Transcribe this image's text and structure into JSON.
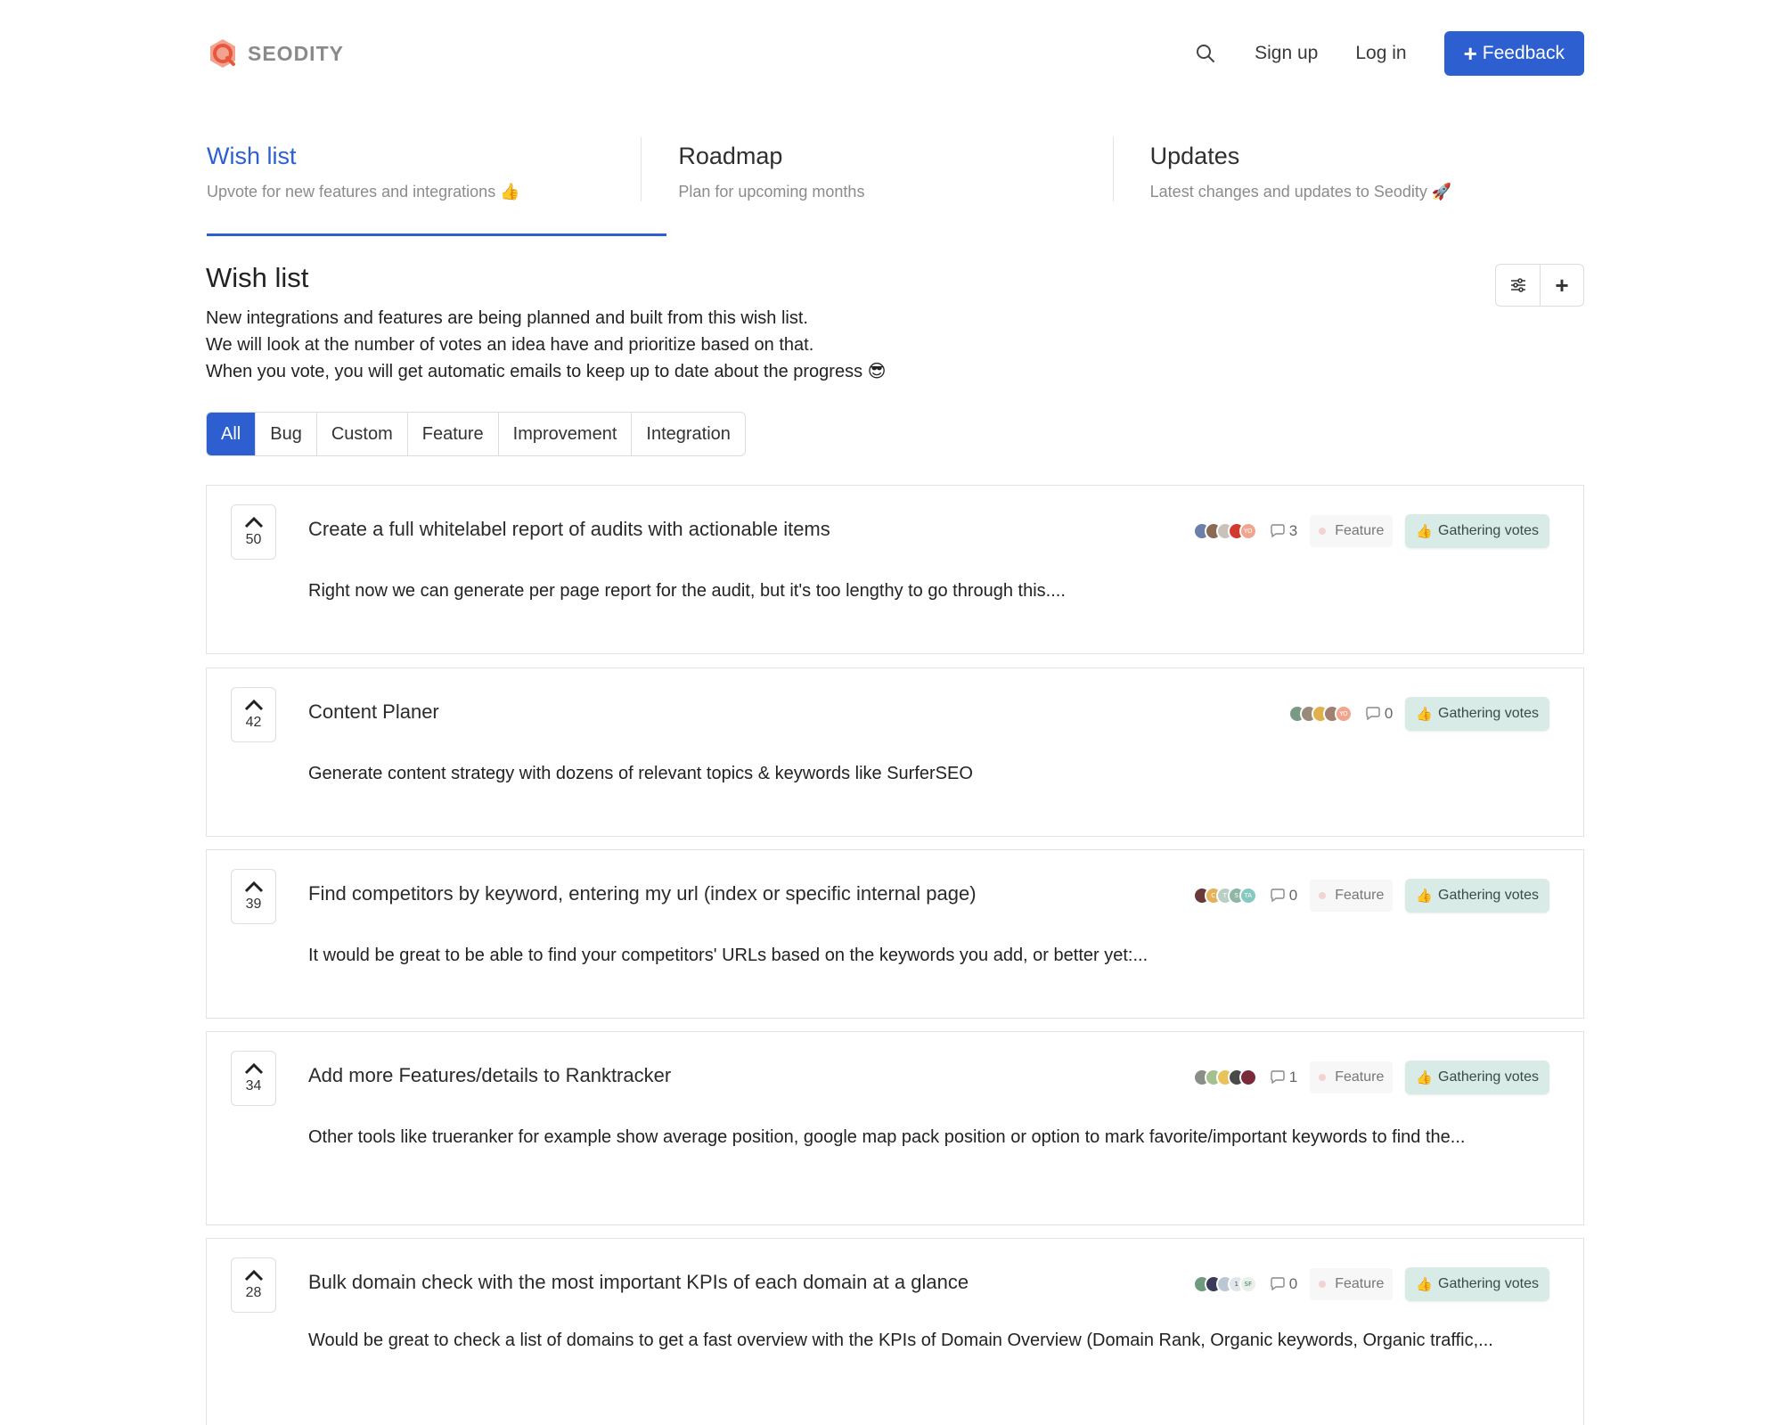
{
  "header": {
    "brand": "SEODITY",
    "signup": "Sign up",
    "login": "Log in",
    "feedback": "Feedback",
    "search_icon": "search-icon"
  },
  "tabs": [
    {
      "title": "Wish list",
      "subtitle": "Upvote for new features and integrations 👍"
    },
    {
      "title": "Roadmap",
      "subtitle": "Plan for upcoming months"
    },
    {
      "title": "Updates",
      "subtitle": "Latest changes and updates to Seodity 🚀"
    }
  ],
  "section": {
    "title": "Wish list",
    "intro": [
      "New integrations and features are being planned and built from this wish list.",
      "We will look at the number of votes an idea have and prioritize based on that.",
      "When you vote, you will get automatic emails to keep up to date about the progress 😎"
    ]
  },
  "filters": [
    "All",
    "Bug",
    "Custom",
    "Feature",
    "Improvement",
    "Integration"
  ],
  "colors": {
    "accent": "#2e5fd1",
    "status_bg": "#d9ebe7"
  },
  "posts": [
    {
      "votes": "50",
      "title": "Create a full whitelabel report of audits with actionable items",
      "desc": "Right now we can generate per page report for the audit, but it's too lengthy to go through this....",
      "comments": "3",
      "type": "Feature",
      "status": "Gathering votes"
    },
    {
      "votes": "42",
      "title": "Content Planer",
      "desc": "Generate content strategy with dozens of relevant topics & keywords like SurferSEO",
      "comments": "0",
      "type": "",
      "status": "Gathering votes"
    },
    {
      "votes": "39",
      "title": "Find competitors by keyword, entering my url (index or specific internal page)",
      "desc": "It would be great to be able to find your competitors' URLs based on the keywords you add, or better yet:...",
      "comments": "0",
      "type": "Feature",
      "status": "Gathering votes"
    },
    {
      "votes": "34",
      "title": "Add more Features/details to Ranktracker",
      "desc": "Other tools like trueranker for example show average position, google map pack position or option to mark favorite/important keywords to find the...",
      "comments": "1",
      "type": "Feature",
      "status": "Gathering votes"
    },
    {
      "votes": "28",
      "title": "Bulk domain check with the most important KPIs of each domain at a glance",
      "desc": "Would be great to check a list of domains to get a fast overview with the KPIs of Domain Overview (Domain Rank, Organic keywords, Organic traffic,...",
      "comments": "0",
      "type": "Feature",
      "status": "Gathering votes"
    }
  ]
}
